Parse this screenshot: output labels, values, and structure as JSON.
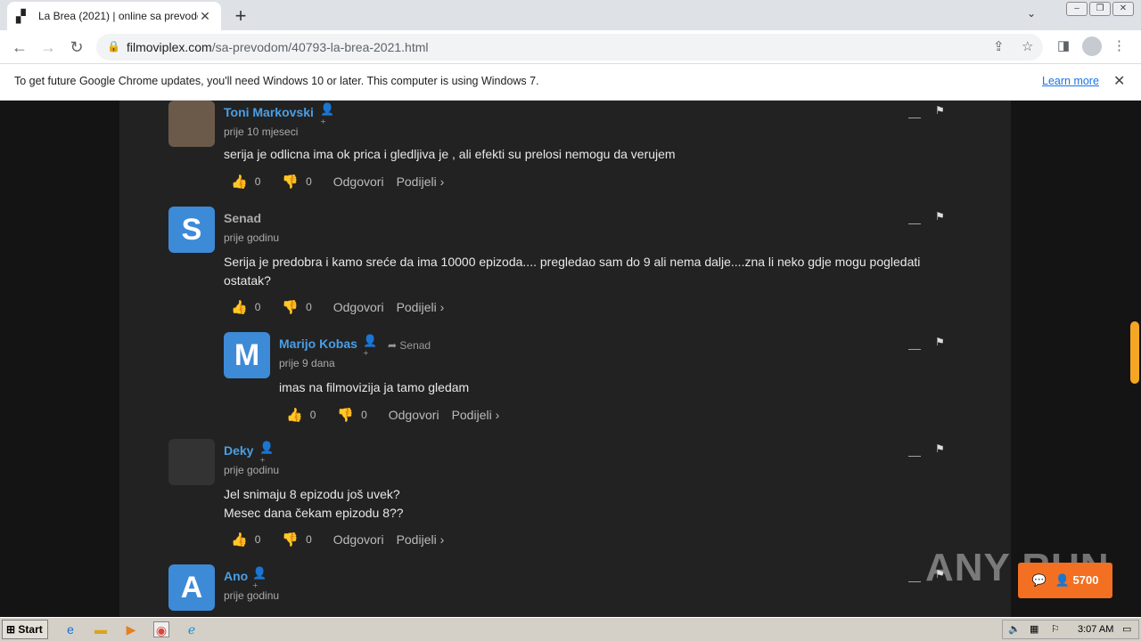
{
  "browser": {
    "tab_title": "La Brea (2021) | online sa prevodom",
    "url_domain": "filmoviplex.com",
    "url_path": "/sa-prevodom/40793-la-brea-2021.html",
    "infobar_message": "To get future Google Chrome updates, you'll need Windows 10 or later. This computer is using Windows 7.",
    "infobar_link": "Learn more"
  },
  "comments": [
    {
      "author": "Toni Markovski",
      "time": "prije 10 mjeseci",
      "text": [
        "serija je odlicna ima ok prica i gledljiva je , ali efekti su prelosi nemogu da verujem"
      ],
      "likes": "0",
      "dislikes": "0",
      "reply_to": "",
      "avatar_letter": ""
    },
    {
      "author": "Senad",
      "time": "prije godinu",
      "text": [
        "Serija je predobra i kamo sreće da ima 10000 epizoda.... pregledao sam do 9 ali nema dalje....zna li neko gdje mogu pogledati ostatak?"
      ],
      "likes": "0",
      "dislikes": "0",
      "reply_to": "",
      "avatar_letter": "S"
    },
    {
      "author": "Marijo Kobas",
      "time": "prije 9 dana",
      "text": [
        "imas na filmovizija ja tamo gledam"
      ],
      "likes": "0",
      "dislikes": "0",
      "reply_to": "Senad",
      "avatar_letter": "M"
    },
    {
      "author": "Deky",
      "time": "prije godinu",
      "text": [
        "Jel snimaju 8 epizodu još uvek?",
        "Mesec dana čekam epizodu 8??"
      ],
      "likes": "0",
      "dislikes": "0",
      "reply_to": "",
      "avatar_letter": ""
    },
    {
      "author": "Ano",
      "time": "prije godinu",
      "text": [],
      "likes": "",
      "dislikes": "",
      "reply_to": "",
      "avatar_letter": "A"
    }
  ],
  "labels": {
    "reply": "Odgovori",
    "share": "Podijeli ›"
  },
  "chat_widget": {
    "count": "5700"
  },
  "taskbar": {
    "start": "Start",
    "clock": "3:07 AM"
  },
  "watermark": "ANY RUN",
  "colors": {
    "accent": "#4a9fe6",
    "scroll_thumb": "#f5a623",
    "chat_button": "#f36f21"
  }
}
